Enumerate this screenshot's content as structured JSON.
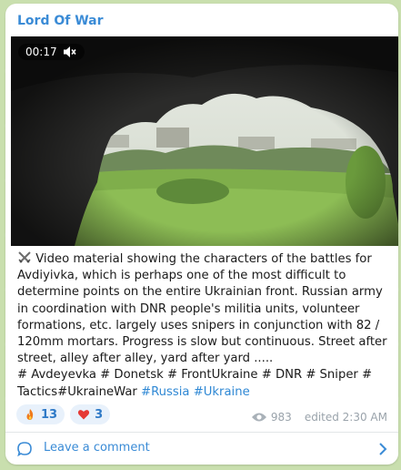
{
  "post": {
    "channel_name": "Lord Of War",
    "video": {
      "duration": "00:17",
      "muted": true
    },
    "text": {
      "body": "Video material showing the characters of the battles for Avdiyivka, which is perhaps one of the most difficult to determine points on the entire Ukrainian front. Russian army in coordination with DNR people's militia units, volunteer formations, etc. largely uses snipers in conjunction with 82 / 120mm mortars. Progress is slow but continuous. Street after street, alley after alley, yard after yard .....",
      "tags_plain": "# Avdeyevka # Donetsk # FrontUkraine # DNR # Sniper # Tactics#UkraineWar",
      "tag_russia": "#Russia",
      "tag_ukraine": "#Ukraine"
    },
    "reactions": [
      {
        "icon": "fire-icon",
        "count": "13"
      },
      {
        "icon": "heart-icon",
        "count": "3"
      }
    ],
    "views": "983",
    "edited": "edited 2:30 AM"
  },
  "comment": {
    "label": "Leave a comment"
  },
  "colors": {
    "accent": "#3a8bd6",
    "background": "#c9dfae",
    "reaction_bg": "#e8f1fb"
  }
}
